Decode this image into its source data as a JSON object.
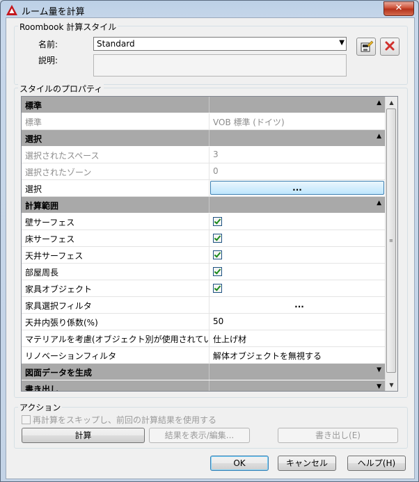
{
  "window": {
    "title": "ルーム量を計算",
    "close_label": "✕"
  },
  "roombook": {
    "group_label": "Roombook 計算スタイル",
    "name_label": "名前:",
    "name_value": "Standard",
    "desc_label": "説明:",
    "desc_value": ""
  },
  "properties": {
    "group_label": "スタイルのプロパティ",
    "categories": {
      "standard": "標準",
      "selection": "選択",
      "calc_range": "計算範囲",
      "drawing": "図面データを生成",
      "export": "書き出し"
    },
    "rows": {
      "standard": {
        "label": "標準",
        "value": "VOB 標準 (ドイツ)"
      },
      "selected_spaces": {
        "label": "選択されたスペース",
        "value": "3"
      },
      "selected_zones": {
        "label": "選択されたゾーン",
        "value": "0"
      },
      "select": {
        "label": "選択",
        "value": "..."
      },
      "wall_surface": {
        "label": "壁サーフェス",
        "checked": true
      },
      "floor_surface": {
        "label": "床サーフェス",
        "checked": true
      },
      "ceiling_surface": {
        "label": "天井サーフェス",
        "checked": true
      },
      "room_perimeter": {
        "label": "部屋周長",
        "checked": true
      },
      "furniture_object": {
        "label": "家具オブジェクト",
        "checked": true
      },
      "furniture_filter": {
        "label": "家具選択フィルタ",
        "value": "..."
      },
      "ceiling_factor": {
        "label": "天井内張り係数(%)",
        "value": "50"
      },
      "material": {
        "label": "マテリアルを考慮(オブジェクト別が使用されてい",
        "value": "仕上げ材"
      },
      "renovation_filter": {
        "label": "リノベーションフィルタ",
        "value": "解体オブジェクトを無視する"
      }
    }
  },
  "action": {
    "group_label": "アクション",
    "checkbox_label": "再計算をスキップし、前回の計算結果を使用する",
    "calc_button": "計算",
    "show_button": "結果を表示/編集...",
    "export_button": "書き出し(E)"
  },
  "footer": {
    "ok": "OK",
    "cancel": "キャンセル",
    "help": "ヘルプ(H)"
  },
  "colors": {
    "category_bg": "#a9a9a9",
    "check": "#1b8a1b",
    "delete": "#d0312d"
  }
}
